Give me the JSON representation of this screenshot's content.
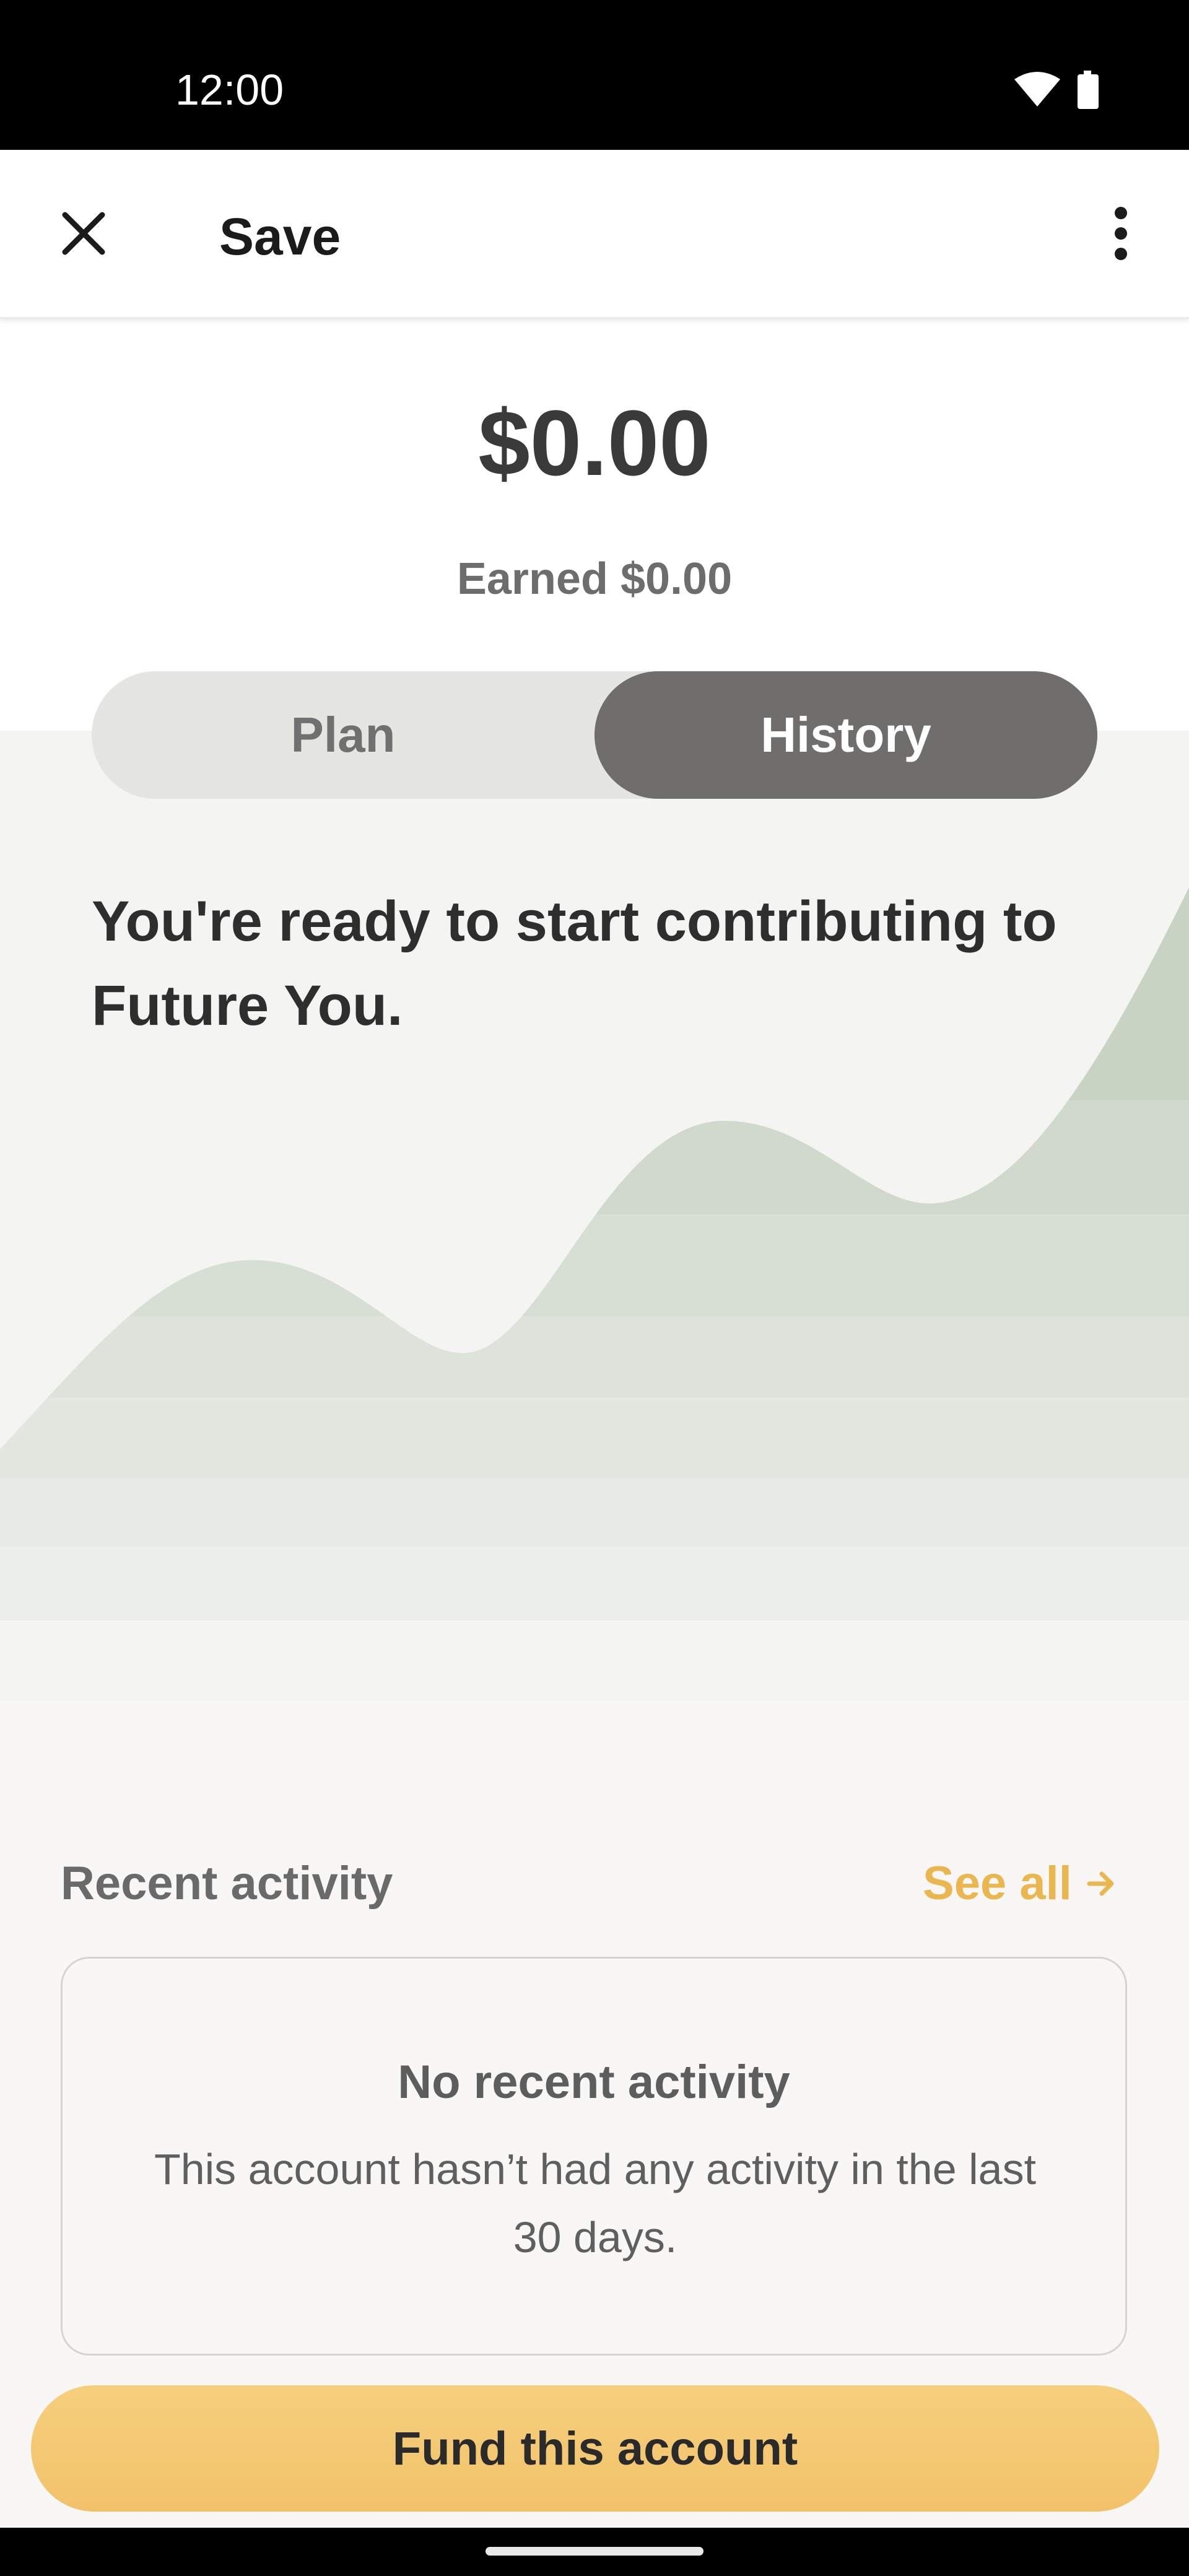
{
  "status_bar": {
    "time": "12:00",
    "icons": [
      "wifi-icon",
      "battery-icon"
    ]
  },
  "app_bar": {
    "title": "Save",
    "close_icon": "close-icon",
    "more_icon": "more-vert-icon"
  },
  "summary": {
    "balance": "$0.00",
    "earned": "Earned $0.00"
  },
  "toggle": {
    "options": [
      {
        "label": "Plan",
        "selected": false
      },
      {
        "label": "History",
        "selected": true
      }
    ]
  },
  "headline": "You're ready to start contributing to Future You.",
  "recent_activity": {
    "label": "Recent activity",
    "see_all": "See all",
    "empty_title": "No recent activity",
    "empty_desc": "This account hasn’t had any activity in the last 30 days."
  },
  "fund_button": {
    "label": "Fund this account"
  },
  "colors": {
    "accent": "#e9b64f",
    "button": "#f2c26a",
    "toggle_selected": "#6f6e6c",
    "chart_fill": "#d3dccf"
  }
}
